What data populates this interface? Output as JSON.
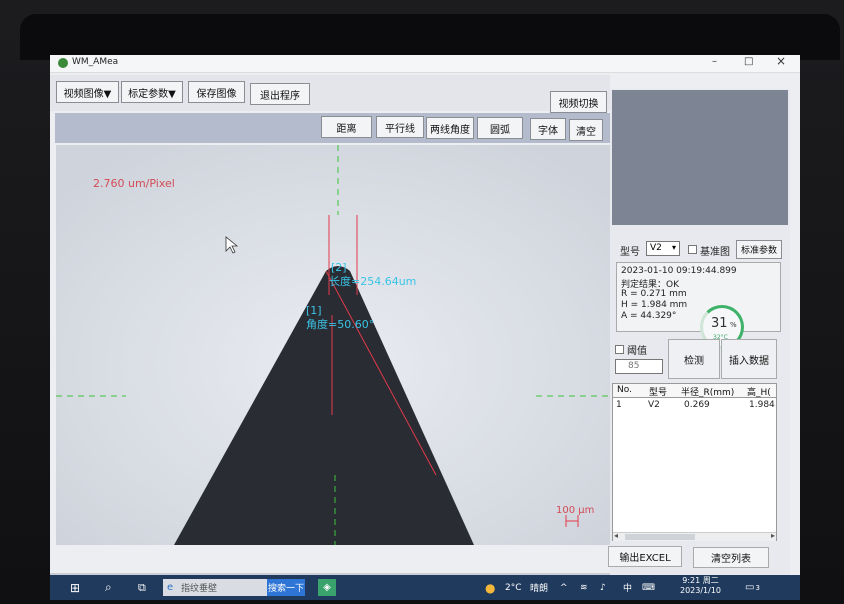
{
  "app": {
    "title": "WM_AMea"
  },
  "window_controls": {
    "minimize": "–",
    "maximize": "□",
    "close": "×"
  },
  "toolbar": {
    "video_image": "视频图像▼",
    "calib_params": "标定参数▼",
    "save_image": "保存图像",
    "exit_program": "退出程序",
    "video_switch": "视频切换"
  },
  "measure_tools": {
    "distance": "距离",
    "parallel": "平行线",
    "two_line_angle": "两线角度",
    "arc": "圆弧",
    "font": "字体",
    "clear": "清空"
  },
  "overlay": {
    "scale": "2.760 um/Pixel",
    "label2": "[2]",
    "length": "长度=254.64um",
    "label1": "[1]",
    "angle": "角度=50.60°",
    "scale_bar": "100 μm"
  },
  "right": {
    "model_label": "型号",
    "model_value": "V2",
    "baseline_label": "基准图",
    "std_params": "标准参数",
    "result_time": "2023-01-10 09:19:44.899",
    "result_judge": "判定结果：OK",
    "result_r": "R = 0.271 mm",
    "result_h": "H = 1.984 mm",
    "result_a": "A = 44.329°",
    "threshold_label": "阈值",
    "threshold_value": "85",
    "detect_btn": "检测",
    "insert_btn": "插入数据",
    "gauge_percent": "31",
    "gauge_unit": "%",
    "gauge_temp": "32°C",
    "export_excel": "输出EXCEL",
    "clear_list": "清空列表"
  },
  "table": {
    "headers": [
      "No.",
      "型号",
      "半径_R(mm)",
      "高_H("
    ],
    "rows": [
      [
        "1",
        "V2",
        "0.269",
        "1.984"
      ]
    ]
  },
  "taskbar": {
    "search_placeholder": "指纹垂壁",
    "search_button": "搜索一下",
    "temperature": "2°C",
    "weather": "晴朗",
    "ime": "中",
    "time": "9:21 周二",
    "date": "2023/1/10",
    "notif_count": "3"
  }
}
